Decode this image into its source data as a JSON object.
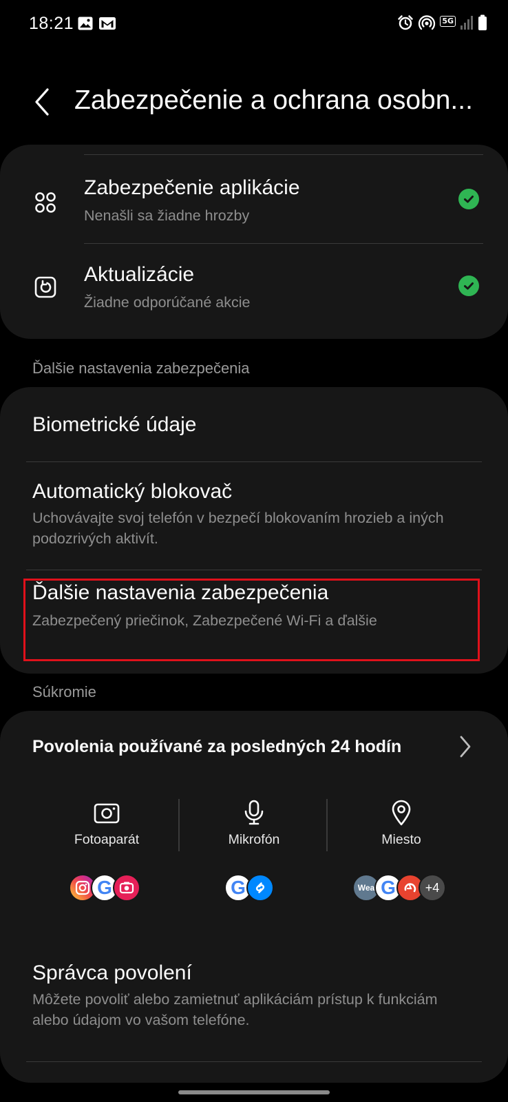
{
  "status_bar": {
    "time": "18:21",
    "network_badge": "5G",
    "left_icons": [
      "gallery-icon",
      "gmail-icon"
    ],
    "right_icons": [
      "alarm-icon",
      "hotspot-icon",
      "network-5g-icon",
      "signal-icon",
      "battery-icon"
    ]
  },
  "header": {
    "title": "Zabezpečenie a ochrana osobn..."
  },
  "security_card": {
    "items": [
      {
        "title": "Zabezpečenie aplikácie",
        "subtitle": "Nenašli sa žiadne hrozby",
        "icon": "apps-grid-icon",
        "status": "ok"
      },
      {
        "title": "Aktualizácie",
        "subtitle": "Žiadne odporúčané akcie",
        "icon": "update-icon",
        "status": "ok"
      }
    ]
  },
  "more_security": {
    "section_label": "Ďalšie nastavenia zabezpečenia",
    "items": [
      {
        "title": "Biometrické údaje"
      },
      {
        "title": "Automatický blokovač",
        "subtitle": "Uchovávajte svoj telefón v bezpečí blokovaním hrozieb a iných podozrivých aktivít."
      },
      {
        "title": "Ďalšie nastavenia zabezpečenia",
        "subtitle": "Zabezpečený priečinok, Zabezpečené Wi-Fi a ďalšie",
        "highlighted": true
      }
    ]
  },
  "privacy": {
    "section_label": "Súkromie",
    "permissions_title": "Povolenia používané za posledných 24 hodín",
    "columns": [
      {
        "label": "Fotoaparát",
        "icon": "camera-icon",
        "apps": [
          "instagram-icon",
          "google-icon",
          "camera-app-icon"
        ]
      },
      {
        "label": "Mikrofón",
        "icon": "microphone-icon",
        "apps": [
          "google-icon",
          "shazam-icon"
        ]
      },
      {
        "label": "Miesto",
        "icon": "location-icon",
        "apps": [
          "weather-icon",
          "google-icon",
          "red-app-icon"
        ],
        "more": "+4"
      }
    ],
    "app_icon_text": {
      "google": "G",
      "weather": "Wea"
    },
    "manager": {
      "title": "Správca povolení",
      "subtitle": "Môžete povoliť alebo zamietnuť aplikáciám prístup k funkciám alebo údajom vo vašom telefóne."
    }
  },
  "colors": {
    "background": "#000000",
    "card": "#171717",
    "check_green": "#2fb553",
    "highlight": "#e0111b"
  }
}
